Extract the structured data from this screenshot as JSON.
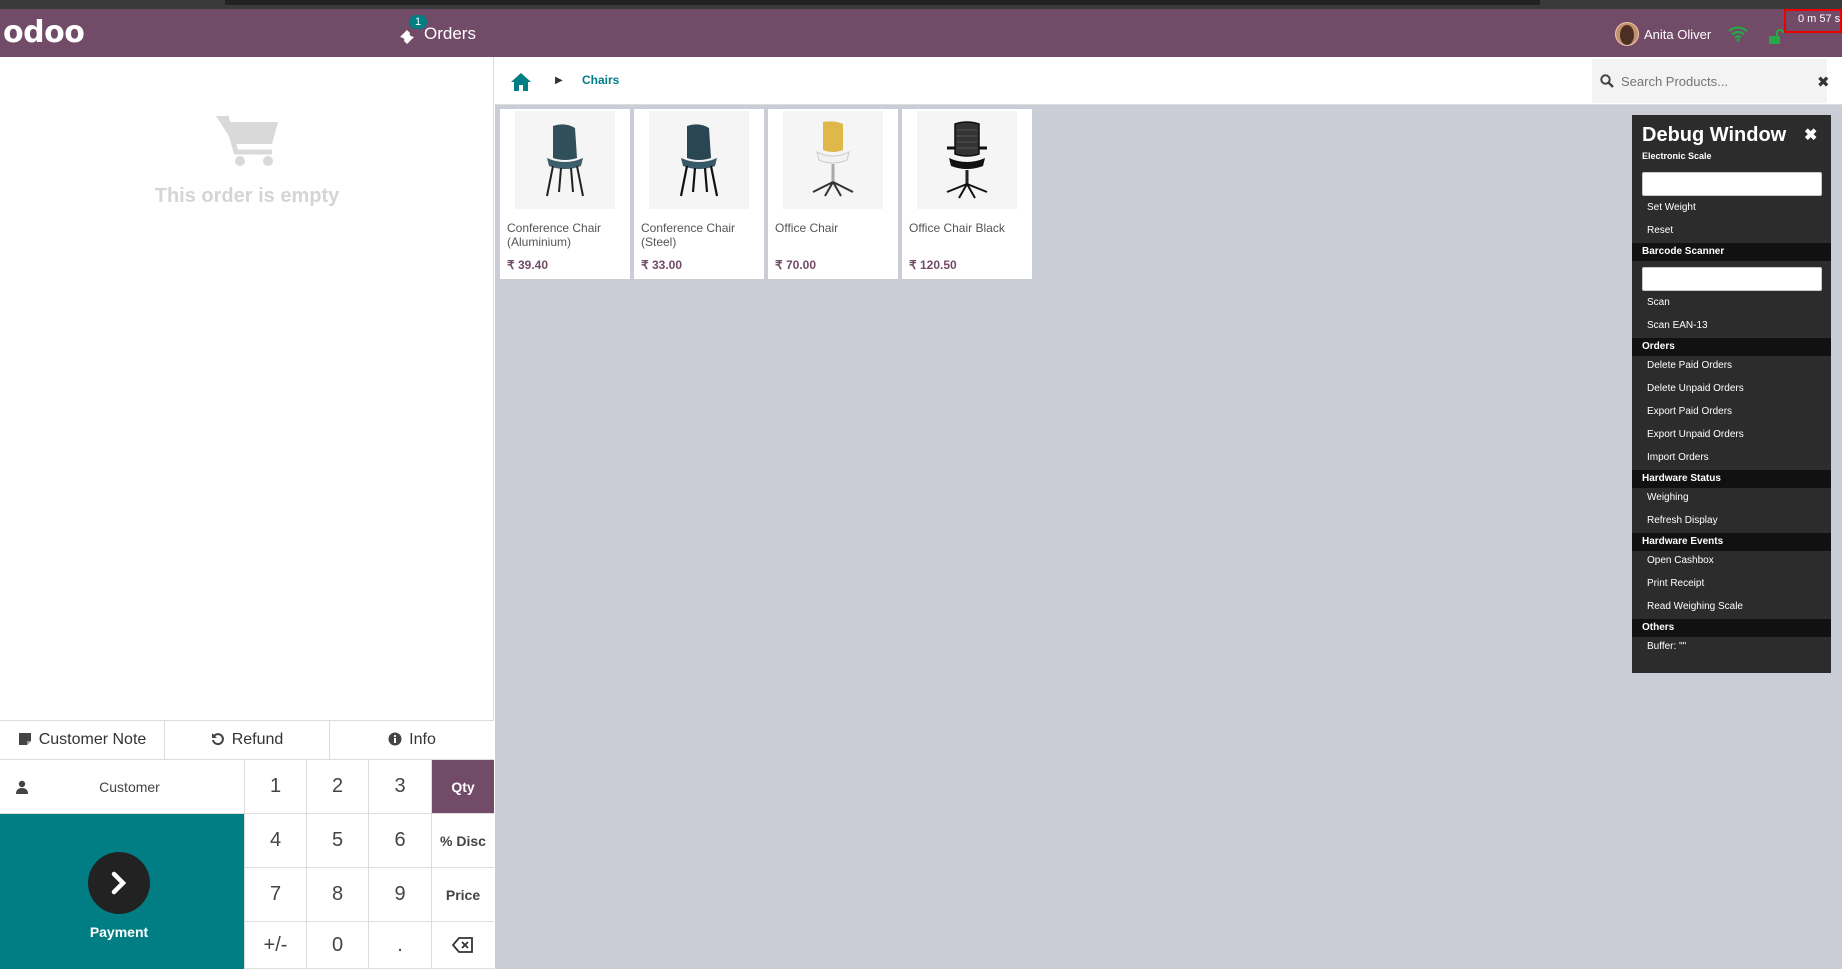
{
  "header": {
    "logo": "odoo",
    "orders_badge": "1",
    "orders_label": "Orders",
    "user_name": "Anita Oliver",
    "timer": "0 m 57 s",
    "colors": {
      "brand": "#714b67",
      "accent": "#017e84",
      "wifi": "#28a745"
    }
  },
  "order": {
    "empty_text": "This order is empty"
  },
  "controls": {
    "customer_note": "Customer Note",
    "refund": "Refund",
    "info": "Info"
  },
  "pad": {
    "customer": "Customer",
    "payment": "Payment",
    "keys": {
      "k1": "1",
      "k2": "2",
      "k3": "3",
      "qty": "Qty",
      "k4": "4",
      "k5": "5",
      "k6": "6",
      "disc": "% Disc",
      "k7": "7",
      "k8": "8",
      "k9": "9",
      "price": "Price",
      "sign": "+/-",
      "k0": "0",
      "dot": "."
    }
  },
  "breadcrumb": {
    "category": "Chairs"
  },
  "search": {
    "placeholder": "Search Products..."
  },
  "products": [
    {
      "name": "Conference Chair (Aluminium)",
      "price": "₹ 39.40"
    },
    {
      "name": "Conference Chair (Steel)",
      "price": "₹ 33.00"
    },
    {
      "name": "Office Chair",
      "price": "₹ 70.00"
    },
    {
      "name": "Office Chair Black",
      "price": "₹ 120.50"
    }
  ],
  "debug": {
    "title": "Debug Window",
    "subtitle": "Electronic Scale",
    "set_weight": "Set Weight",
    "reset": "Reset",
    "barcode_section": "Barcode Scanner",
    "scan": "Scan",
    "scan_ean": "Scan EAN-13",
    "orders_section": "Orders",
    "delete_paid": "Delete Paid Orders",
    "delete_unpaid": "Delete Unpaid Orders",
    "export_paid": "Export Paid Orders",
    "export_unpaid": "Export Unpaid Orders",
    "import_orders": "Import Orders",
    "hw_status_section": "Hardware Status",
    "weighing": "Weighing",
    "refresh_display": "Refresh Display",
    "hw_events_section": "Hardware Events",
    "open_cashbox": "Open Cashbox",
    "print_receipt": "Print Receipt",
    "read_scale": "Read Weighing Scale",
    "others_section": "Others",
    "buffer": "Buffer: \"\""
  }
}
